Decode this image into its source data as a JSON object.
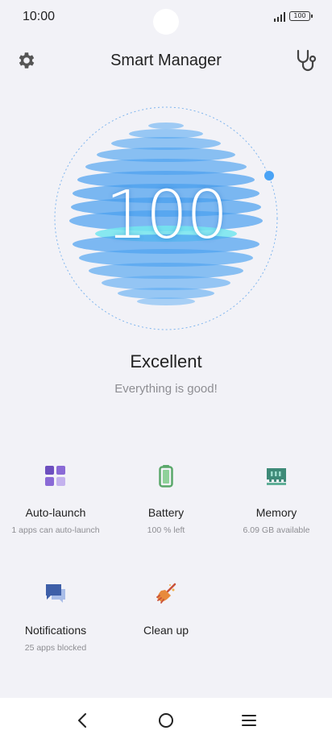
{
  "status_bar": {
    "time": "10:00",
    "battery_level": "100",
    "icons": [
      "camera-cutout",
      "signal-icon",
      "battery-icon"
    ]
  },
  "header": {
    "title": "Smart Manager",
    "left_icon": "gear-icon",
    "right_icon": "stethoscope-icon"
  },
  "score": {
    "value": "100",
    "status": "Excellent",
    "message": "Everything is good!",
    "accent_color": "#4aa3f5"
  },
  "tiles": [
    {
      "label": "Auto-launch",
      "sub": "1 apps can auto-launch",
      "icon": "apps-grid-icon",
      "color": "#7a5cc8"
    },
    {
      "label": "Battery",
      "sub": "100 % left",
      "icon": "battery-icon",
      "color": "#5aa86a"
    },
    {
      "label": "Memory",
      "sub": "6.09 GB available",
      "icon": "memory-chip-icon",
      "color": "#3e8a78"
    },
    {
      "label": "Notifications",
      "sub": "25 apps blocked",
      "icon": "chat-bubbles-icon",
      "color": "#3e5fa8"
    },
    {
      "label": "Clean up",
      "sub": "",
      "icon": "broom-icon",
      "color": "#e06a2c"
    }
  ],
  "nav": {
    "buttons": [
      "back-icon",
      "home-icon",
      "menu-icon"
    ]
  }
}
